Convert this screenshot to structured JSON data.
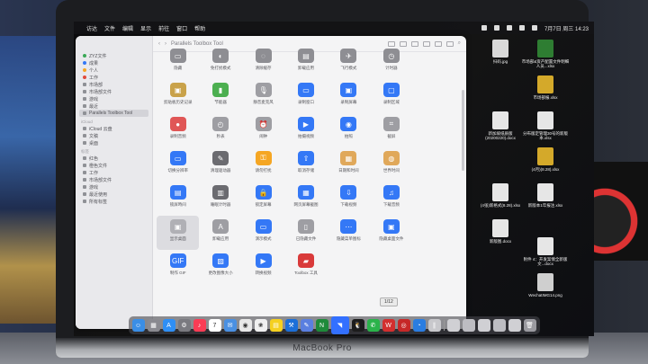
{
  "menubar": {
    "apple": "",
    "items": [
      "访达",
      "文件",
      "编辑",
      "显示",
      "前往",
      "窗口",
      "帮助"
    ],
    "clock": "7月7日 周三  14:23"
  },
  "window": {
    "title": "Parallels Toolbox Tool",
    "sidebar": {
      "tags": [
        {
          "label": "ZYZ文件",
          "color": "#3aa856"
        },
        {
          "label": "成果",
          "color": "#3478f6"
        },
        {
          "label": "个人",
          "color": "#f5a623"
        },
        {
          "label": "工作",
          "color": "#e04a3a"
        },
        {
          "label": "市场部",
          "color": "#6b6b70"
        },
        {
          "label": "市场部文件",
          "color": "#6b6b70"
        },
        {
          "label": "游戏",
          "color": "#6b6b70"
        },
        {
          "label": "最近",
          "color": "#6b6b70"
        },
        {
          "label": "Parallels Toolbox Tool",
          "color": "#6b6b70"
        }
      ],
      "section_label_1": "iCloud",
      "icloud": [
        "iCloud 云盘",
        "文稿",
        "桌面"
      ],
      "section_label_2": "标签",
      "labels": [
        "红色",
        "橙色文件",
        "工作",
        "市场部文件",
        "游戏",
        "最近使用",
        "所有标签"
      ]
    },
    "tools": [
      {
        "label": "隐藏",
        "color": "#8e8e93",
        "glyph": "▭"
      },
      {
        "label": "免打扰模式",
        "color": "#8e8e93",
        "glyph": "◐"
      },
      {
        "label": "清除缓存",
        "color": "#8e8e93",
        "glyph": "◌"
      },
      {
        "label": "卸载应用",
        "color": "#8e8e93",
        "glyph": "▤"
      },
      {
        "label": "飞行模式",
        "color": "#8e8e93",
        "glyph": "✈"
      },
      {
        "label": "计时器",
        "color": "#8e8e93",
        "glyph": "◷"
      },
      {
        "label": "",
        "color": "transparent",
        "glyph": ""
      },
      {
        "label": "剪贴板历史记录",
        "color": "#c9a24a",
        "glyph": "▣"
      },
      {
        "label": "节能器",
        "color": "#4caf50",
        "glyph": "▮"
      },
      {
        "label": "静音麦克风",
        "color": "#9e9ea3",
        "glyph": "🎙"
      },
      {
        "label": "录制窗口",
        "color": "#3478f6",
        "glyph": "▭"
      },
      {
        "label": "录制屏幕",
        "color": "#3478f6",
        "glyph": "▣"
      },
      {
        "label": "录制区域",
        "color": "#3478f6",
        "glyph": "▢"
      },
      {
        "label": "",
        "color": "transparent",
        "glyph": ""
      },
      {
        "label": "录制音频",
        "color": "#e05656",
        "glyph": "●"
      },
      {
        "label": "秒表",
        "color": "#9e9ea3",
        "glyph": "◴"
      },
      {
        "label": "闹钟",
        "color": "#9e9ea3",
        "glyph": "⏰"
      },
      {
        "label": "拍摄视频",
        "color": "#3478f6",
        "glyph": "▶"
      },
      {
        "label": "拍照",
        "color": "#3478f6",
        "glyph": "◉"
      },
      {
        "label": "截屏",
        "color": "#9e9ea3",
        "glyph": "⌗"
      },
      {
        "label": "",
        "color": "transparent",
        "glyph": ""
      },
      {
        "label": "切换分辨率",
        "color": "#3478f6",
        "glyph": "▭"
      },
      {
        "label": "清理驱动器",
        "color": "#6b6b70",
        "glyph": "✎"
      },
      {
        "label": "请勿打扰",
        "color": "#f5a623",
        "glyph": "⚿"
      },
      {
        "label": "取消存储",
        "color": "#3478f6",
        "glyph": "⇧"
      },
      {
        "label": "日期和时间",
        "color": "#e0a85a",
        "glyph": "▦"
      },
      {
        "label": "世界时间",
        "color": "#e0a85a",
        "glyph": "◍"
      },
      {
        "label": "",
        "color": "transparent",
        "glyph": ""
      },
      {
        "label": "锁屏時间",
        "color": "#3478f6",
        "glyph": "▤"
      },
      {
        "label": "睡眠计时器",
        "color": "#6b6b70",
        "glyph": "▥"
      },
      {
        "label": "锁定屏幕",
        "color": "#3478f6",
        "glyph": "🔒"
      },
      {
        "label": "网页屏幕截图",
        "color": "#3478f6",
        "glyph": "▦"
      },
      {
        "label": "下载视频",
        "color": "#3478f6",
        "glyph": "⇩"
      },
      {
        "label": "下载音频",
        "color": "#3478f6",
        "glyph": "♫"
      },
      {
        "label": "",
        "color": "transparent",
        "glyph": ""
      },
      {
        "label": "显示桌面",
        "color": "#b0b0b5",
        "glyph": "▣"
      },
      {
        "label": "卸载应用",
        "color": "#9e9ea3",
        "glyph": "A"
      },
      {
        "label": "演示模式",
        "color": "#3478f6",
        "glyph": "▭"
      },
      {
        "label": "已隐藏文件",
        "color": "#9e9ea3",
        "glyph": "▯"
      },
      {
        "label": "隐藏菜单图标",
        "color": "#3478f6",
        "glyph": "⋯"
      },
      {
        "label": "隐藏桌面文件",
        "color": "#3478f6",
        "glyph": "▣"
      },
      {
        "label": "",
        "color": "transparent",
        "glyph": ""
      },
      {
        "label": "制作 GIF",
        "color": "#3478f6",
        "glyph": "GIF"
      },
      {
        "label": "更改图像大小",
        "color": "#3478f6",
        "glyph": "▨"
      },
      {
        "label": "转换视频",
        "color": "#3478f6",
        "glyph": "▶"
      },
      {
        "label": "Toolbox 工具",
        "color": "#d93a3a",
        "glyph": "▰"
      }
    ],
    "hover_tooltip": "1/12"
  },
  "desktop": [
    {
      "label": "扫码.jpg",
      "color": "#d9d9d9"
    },
    {
      "label": "市场部&资产配置文件明细人员...xlsx",
      "color": "#2e7d32"
    },
    {
      "label": "市场部报.xlsx",
      "color": "#d4a92a"
    },
    {
      "label": "新加坡纸质版(20200220).docx",
      "color": "#e6e6e6"
    },
    {
      "label": "分布版定管理30号的新版本.xlsx",
      "color": "#e6e6e6"
    },
    {
      "label": "(4月)(8.28).xlsx",
      "color": "#d4a92a"
    },
    {
      "label": "(4张)新格式(8.28).xlsx",
      "color": "#e6e6e6"
    },
    {
      "label": "新版图.docx",
      "color": "#e6e6e6"
    },
    {
      "label": "新版本1年报注.xlsx",
      "color": "#e6e6e6"
    },
    {
      "label": "附件 4：开发案情全新版文...docx",
      "color": "#e6e6e6"
    },
    {
      "label": "WechatIMG14.png",
      "color": "#cfcfcf"
    }
  ],
  "dock": [
    {
      "name": "finder",
      "color": "#3a8ee6",
      "glyph": "☺"
    },
    {
      "name": "launchpad",
      "color": "#8a8a90",
      "glyph": "▦"
    },
    {
      "name": "app-store",
      "color": "#2f8ff5",
      "glyph": "A"
    },
    {
      "name": "system-preferences",
      "color": "#7a7a80",
      "glyph": "⚙"
    },
    {
      "name": "music",
      "color": "#fa3c55",
      "glyph": "♪"
    },
    {
      "name": "calendar",
      "color": "#ffffff",
      "glyph": "7"
    },
    {
      "name": "mail",
      "color": "#4a90e2",
      "glyph": "✉"
    },
    {
      "name": "chrome",
      "color": "#e8e8e8",
      "glyph": "◉"
    },
    {
      "name": "photos",
      "color": "#f0f0f0",
      "glyph": "❀"
    },
    {
      "name": "notes",
      "color": "#f5d020",
      "glyph": "▤"
    },
    {
      "name": "xcode",
      "color": "#1c6fd8",
      "glyph": "⚒"
    },
    {
      "name": "pen",
      "color": "#5a7fe0",
      "glyph": "✎"
    },
    {
      "name": "microsoft",
      "color": "#1e8a3a",
      "glyph": "N"
    },
    {
      "name": "lark",
      "color": "#3370ff",
      "glyph": "◥"
    },
    {
      "name": "qq",
      "color": "#1c1c1c",
      "glyph": "🐧"
    },
    {
      "name": "wechat",
      "color": "#2ab34a",
      "glyph": "✆"
    },
    {
      "name": "wps",
      "color": "#d32f2f",
      "glyph": "W"
    },
    {
      "name": "netease",
      "color": "#c62828",
      "glyph": "◎"
    },
    {
      "name": "safari",
      "color": "#2a7de1",
      "glyph": "◔"
    },
    {
      "name": "parallels",
      "color": "#c8c8cc",
      "glyph": "∥"
    },
    {
      "name": "doc1",
      "color": "#d0d0d4",
      "glyph": ""
    },
    {
      "name": "doc2",
      "color": "#bdbdc2",
      "glyph": ""
    },
    {
      "name": "doc3",
      "color": "#d0d0d4",
      "glyph": ""
    },
    {
      "name": "doc4",
      "color": "#bdbdc2",
      "glyph": ""
    },
    {
      "name": "doc5",
      "color": "#d0d0d4",
      "glyph": ""
    },
    {
      "name": "trash",
      "color": "#9a9aa0",
      "glyph": "🗑"
    }
  ],
  "laptop_brand": "MacBook Pro"
}
